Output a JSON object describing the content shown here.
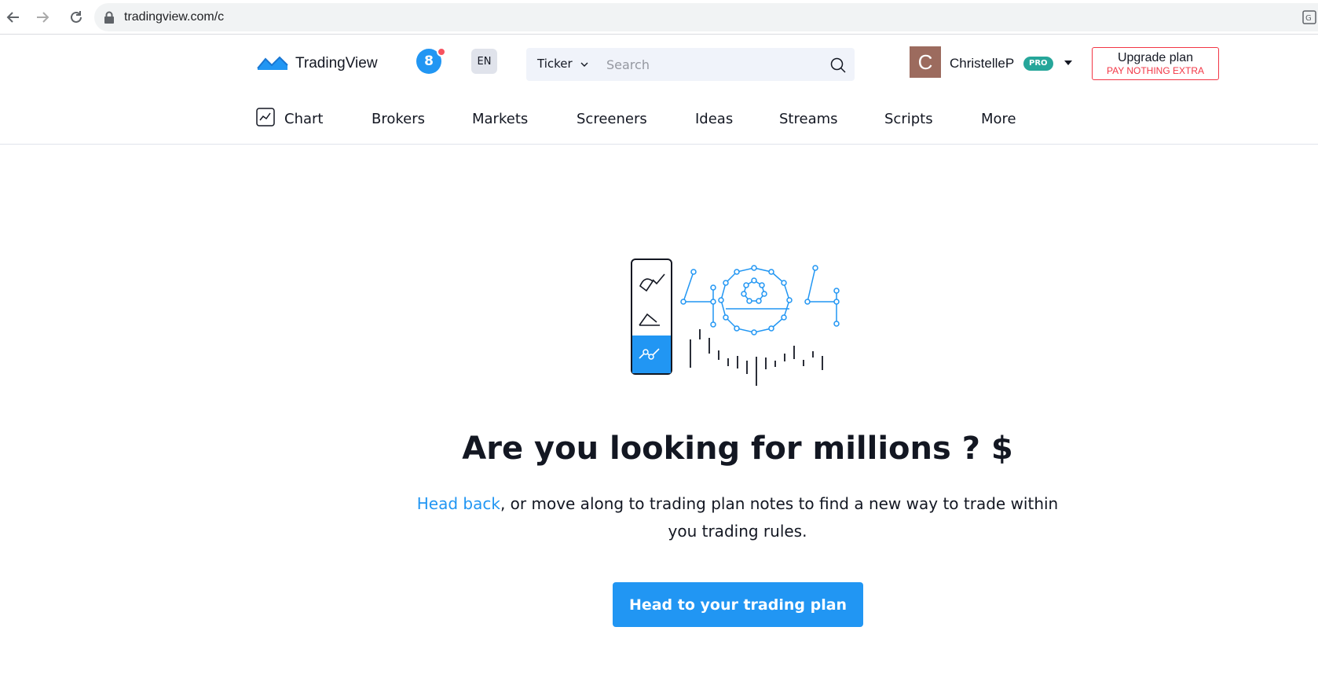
{
  "browser": {
    "url": "tradingview.com/c",
    "icons": [
      "back-arrow-icon",
      "forward-arrow-icon",
      "reload-icon",
      "lock-icon",
      "translate-icon"
    ]
  },
  "header": {
    "brand": "TradingView",
    "notifications_count": "8",
    "language": "EN",
    "search": {
      "ticker_label": "Ticker",
      "placeholder": "Search"
    },
    "user": {
      "avatar_letter": "C",
      "name": "ChristelleP",
      "badge": "PRO"
    },
    "upgrade": {
      "title": "Upgrade plan",
      "subtitle": "PAY NOTHING EXTRA"
    },
    "menu": [
      "Chart",
      "Brokers",
      "Markets",
      "Screeners",
      "Ideas",
      "Streams",
      "Scripts",
      "More"
    ]
  },
  "main": {
    "illustration_text": "404",
    "headline": "Are you looking for millions ? $",
    "link_text": "Head back",
    "description_rest": ", or move along to trading plan notes to find a new way to trade within you trading rules.",
    "cta_label": "Head to your trading plan"
  },
  "colors": {
    "accent": "#2196f3",
    "danger": "#f23645",
    "pro_badge": "#26a69a",
    "notification_dot": "#f7525f",
    "avatar_bg": "#9c6b5e"
  }
}
